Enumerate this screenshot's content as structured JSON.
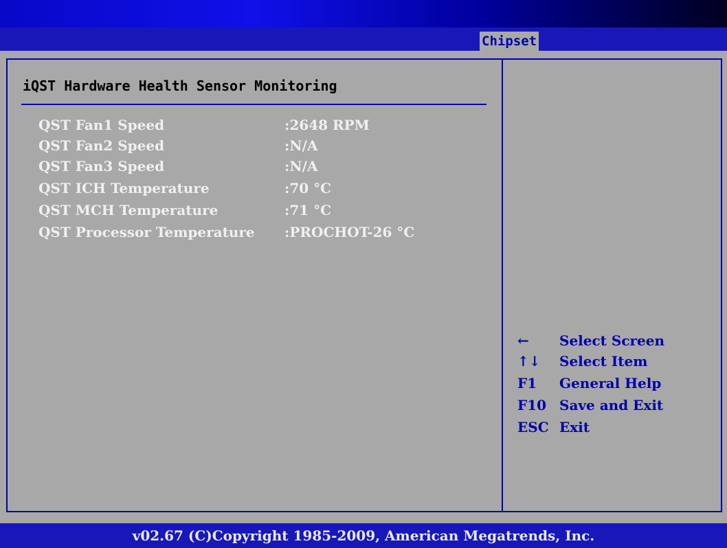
{
  "tabs": [
    {
      "label": "Chipset"
    }
  ],
  "main": {
    "title": "iQST Hardware Health Sensor Monitoring",
    "rows": [
      {
        "label": "QST Fan1 Speed",
        "value": ":2648 RPM"
      },
      {
        "label": "QST Fan2 Speed",
        "value": ":N/A"
      },
      {
        "label": "QST Fan3 Speed",
        "value": ":N/A"
      },
      {
        "label": "QST ICH Temperature",
        "value": ":70 °C"
      },
      {
        "label": "QST MCH Temperature",
        "value": ":71 °C"
      },
      {
        "label": "QST Processor Temperature",
        "value": ":PROCHOT-26 °C"
      }
    ]
  },
  "help": {
    "items": [
      {
        "key": "←",
        "desc": "Select Screen"
      },
      {
        "key": "↑↓",
        "desc": "Select Item"
      },
      {
        "key": "F1",
        "desc": "General Help"
      },
      {
        "key": "F10",
        "desc": "Save and Exit"
      },
      {
        "key": "ESC",
        "desc": "Exit"
      }
    ]
  },
  "footer": {
    "text": "v02.67 (C)Copyright 1985-2009, American Megatrends, Inc."
  },
  "colors": {
    "panel": "#a8a8a8",
    "accent": "#0000a8",
    "bar": "#1818b8"
  }
}
